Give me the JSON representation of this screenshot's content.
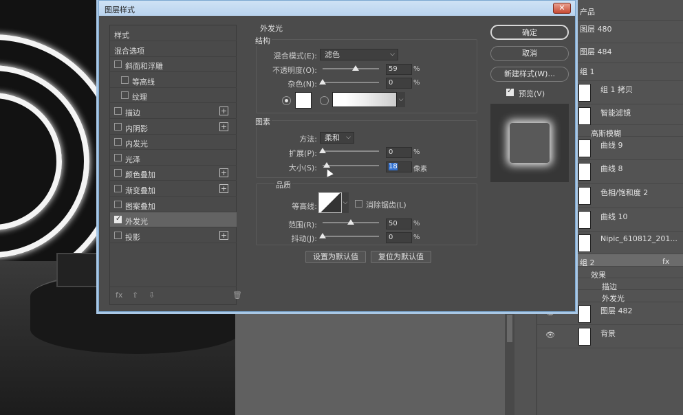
{
  "dialog": {
    "title": "图层样式",
    "close_label": "✕",
    "styles": [
      {
        "label": "样式",
        "checkbox": false,
        "checked": false,
        "plus": false,
        "indent": 0
      },
      {
        "label": "混合选项",
        "checkbox": false,
        "checked": false,
        "plus": false,
        "indent": 0
      },
      {
        "label": "斜面和浮雕",
        "checkbox": true,
        "checked": false,
        "plus": false,
        "indent": 0
      },
      {
        "label": "等高线",
        "checkbox": true,
        "checked": false,
        "plus": false,
        "indent": 1
      },
      {
        "label": "纹理",
        "checkbox": true,
        "checked": false,
        "plus": false,
        "indent": 1
      },
      {
        "label": "描边",
        "checkbox": true,
        "checked": false,
        "plus": true,
        "indent": 0
      },
      {
        "label": "内阴影",
        "checkbox": true,
        "checked": false,
        "plus": true,
        "indent": 0
      },
      {
        "label": "内发光",
        "checkbox": true,
        "checked": false,
        "plus": false,
        "indent": 0
      },
      {
        "label": "光泽",
        "checkbox": true,
        "checked": false,
        "plus": false,
        "indent": 0
      },
      {
        "label": "颜色叠加",
        "checkbox": true,
        "checked": false,
        "plus": true,
        "indent": 0
      },
      {
        "label": "渐变叠加",
        "checkbox": true,
        "checked": false,
        "plus": true,
        "indent": 0
      },
      {
        "label": "图案叠加",
        "checkbox": true,
        "checked": false,
        "plus": false,
        "indent": 0
      },
      {
        "label": "外发光",
        "checkbox": true,
        "checked": true,
        "plus": false,
        "indent": 0,
        "active": true
      },
      {
        "label": "投影",
        "checkbox": true,
        "checked": false,
        "plus": true,
        "indent": 0
      }
    ],
    "footer": {
      "fx": "fx",
      "up": "⇧",
      "down": "⇩",
      "trash": "🗑"
    },
    "outer_glow": {
      "heading": "外发光",
      "structure": {
        "title": "结构",
        "blend_label": "混合模式(E):",
        "blend_value": "滤色",
        "opacity_label": "不透明度(O):",
        "opacity_value": "59",
        "opacity": 59,
        "noise_label": "杂色(N):",
        "noise_value": "0",
        "noise": 0,
        "unit": "%"
      },
      "elements": {
        "title": "图素",
        "method_label": "方法:",
        "method_value": "柔和",
        "spread_label": "扩展(P):",
        "spread_value": "0",
        "spread": 0,
        "size_label": "大小(S):",
        "size_value": "18",
        "size": 18,
        "size_unit": "像素",
        "unit": "%"
      },
      "quality": {
        "title": "品质",
        "contour_label": "等高线:",
        "antialias_label": "消除锯齿(L)",
        "range_label": "范围(R):",
        "range_value": "50",
        "range": 50,
        "jitter_label": "抖动(J):",
        "jitter_value": "0",
        "jitter": 0,
        "unit": "%"
      },
      "set_default": "设置为默认值",
      "reset_default": "复位为默认值"
    },
    "buttons": {
      "ok": "确定",
      "cancel": "取消",
      "new_style": "新建样式(W)..."
    },
    "preview_label": "预览(V)"
  },
  "layers": [
    {
      "name": "产品",
      "thumb": false,
      "indent": 0
    },
    {
      "name": "图层 480",
      "thumb": false,
      "indent": 0
    },
    {
      "name": "图层 484",
      "thumb": false,
      "indent": 0
    },
    {
      "name": "组 1",
      "thumb": false,
      "indent": 0
    },
    {
      "name": "组 1 拷贝",
      "thumb": true,
      "indent": 1
    },
    {
      "name": "智能滤镜",
      "thumb": true,
      "indent": 1
    },
    {
      "name": "高斯模糊",
      "thumb": false,
      "indent": 1
    },
    {
      "name": "曲线 9",
      "thumb": true,
      "indent": 1
    },
    {
      "name": "曲线 8",
      "thumb": true,
      "indent": 1
    },
    {
      "name": "色相/饱和度 2",
      "thumb": true,
      "indent": 1
    },
    {
      "name": "曲线 10",
      "thumb": true,
      "indent": 1
    },
    {
      "name": "Nipic_610812_201...",
      "thumb": true,
      "indent": 1
    },
    {
      "name": "组 2",
      "thumb": false,
      "indent": 0,
      "selected": true,
      "fx": "fx"
    },
    {
      "name": "效果",
      "thumb": false,
      "indent": 1
    },
    {
      "name": "描边",
      "thumb": false,
      "indent": 2
    },
    {
      "name": "外发光",
      "thumb": false,
      "indent": 2
    },
    {
      "name": "图层 482",
      "thumb": true,
      "indent": 0
    },
    {
      "name": "背景",
      "thumb": true,
      "indent": 0
    }
  ],
  "colors": {
    "dialog_bg": "#4b4b4b",
    "panel_bg": "#535353",
    "title_bar": "#b9d3ee",
    "highlight": "#2f6fd0"
  }
}
